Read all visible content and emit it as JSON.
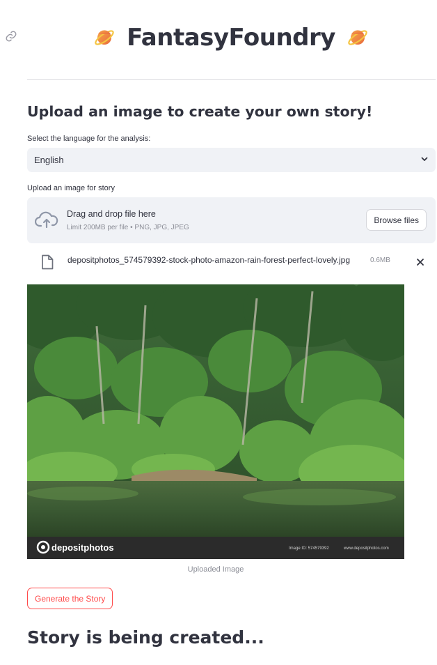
{
  "app": {
    "title": "FantasyFoundry"
  },
  "header": {
    "title_icon_left": "ringed-planet-icon",
    "title_icon_right": "ringed-planet-icon",
    "anchor_icon": "link-icon"
  },
  "main": {
    "subheader": "Upload an image to create your own story!",
    "language_select": {
      "label": "Select the language for the analysis:",
      "value": "English",
      "icon": "chevron-down-icon"
    },
    "uploader": {
      "label": "Upload an image for story",
      "drop_title": "Drag and drop file here",
      "drop_subtitle": "Limit 200MB per file • PNG, JPG, JPEG",
      "browse_label": "Browse files",
      "icon": "cloud-upload-icon"
    },
    "uploaded_file": {
      "name": "depositphotos_574579392-stock-photo-amazon-rain-forest-perfect-lovely.jpg",
      "size": "0.6MB",
      "icon": "file-icon",
      "remove_icon": "close-icon"
    },
    "image": {
      "watermark_brand": "depositphotos",
      "watermark_id": "Image ID: 574579392",
      "watermark_site": "www.depositphotos.com",
      "caption": "Uploaded Image"
    },
    "generate_button": "Generate the Story",
    "status_heading": "Story is being created..."
  },
  "colors": {
    "text": "#31333f",
    "accent": "#ff4b4b",
    "widget_bg": "#f0f2f6",
    "muted": "#8b8d96"
  }
}
